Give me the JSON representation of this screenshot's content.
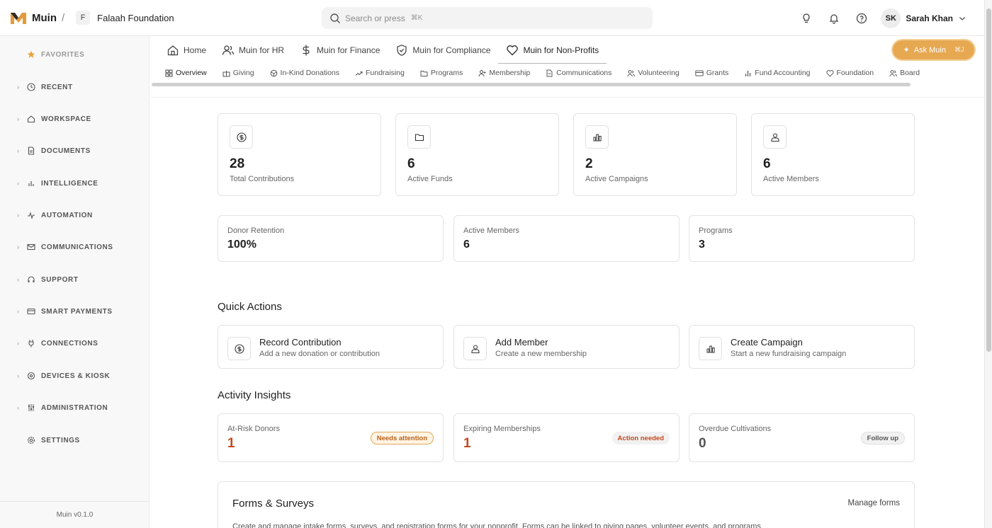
{
  "brand": {
    "name": "Muin",
    "accent": "#e7a852"
  },
  "org": {
    "initial": "F",
    "name": "Falaah Foundation"
  },
  "search": {
    "placeholder": "Search or press",
    "shortcut": "⌘K"
  },
  "user": {
    "initials": "SK",
    "name": "Sarah Khan"
  },
  "sidebar": {
    "items": [
      {
        "label": "FAVORITES",
        "icon": "star-icon"
      },
      {
        "label": "RECENT",
        "icon": "clock-icon"
      },
      {
        "label": "WORKSPACE",
        "icon": "home-icon"
      },
      {
        "label": "DOCUMENTS",
        "icon": "document-icon"
      },
      {
        "label": "INTELLIGENCE",
        "icon": "bar-chart-icon"
      },
      {
        "label": "AUTOMATION",
        "icon": "activity-icon"
      },
      {
        "label": "COMMUNICATIONS",
        "icon": "mail-icon"
      },
      {
        "label": "SUPPORT",
        "icon": "headset-icon"
      },
      {
        "label": "SMART PAYMENTS",
        "icon": "card-icon"
      },
      {
        "label": "CONNECTIONS",
        "icon": "plug-icon"
      },
      {
        "label": "DEVICES & KIOSK",
        "icon": "kiosk-icon"
      },
      {
        "label": "ADMINISTRATION",
        "icon": "sliders-icon"
      },
      {
        "label": "SETTINGS",
        "icon": "settings-icon"
      }
    ],
    "version": "Muin v0.1.0"
  },
  "main_tabs": [
    {
      "label": "Home",
      "icon": "home-icon"
    },
    {
      "label": "Muin for HR",
      "icon": "users-icon"
    },
    {
      "label": "Muin for Finance",
      "icon": "dollar-icon"
    },
    {
      "label": "Muin for Compliance",
      "icon": "shield-icon"
    },
    {
      "label": "Muin for Non-Profits",
      "icon": "heart-icon",
      "active": true
    }
  ],
  "ask_button": {
    "label": "Ask Muin",
    "shortcut": "⌘J"
  },
  "sub_tabs": [
    {
      "label": "Overview",
      "icon": "grid-icon",
      "active": true
    },
    {
      "label": "Giving",
      "icon": "gift-icon"
    },
    {
      "label": "In-Kind Donations",
      "icon": "package-icon"
    },
    {
      "label": "Fundraising",
      "icon": "trend-icon"
    },
    {
      "label": "Programs",
      "icon": "folder-icon"
    },
    {
      "label": "Membership",
      "icon": "user-plus-icon"
    },
    {
      "label": "Communications",
      "icon": "file-icon"
    },
    {
      "label": "Volunteering",
      "icon": "users-icon"
    },
    {
      "label": "Grants",
      "icon": "card-icon"
    },
    {
      "label": "Fund Accounting",
      "icon": "bar-chart-icon"
    },
    {
      "label": "Foundation",
      "icon": "heart-icon"
    },
    {
      "label": "Board",
      "icon": "users-icon"
    }
  ],
  "stats": [
    {
      "value": "28",
      "label": "Total Contributions",
      "icon": "dollar-circle-icon"
    },
    {
      "value": "6",
      "label": "Active Funds",
      "icon": "folder-icon"
    },
    {
      "value": "2",
      "label": "Active Campaigns",
      "icon": "bar-chart-icon"
    },
    {
      "value": "6",
      "label": "Active Members",
      "icon": "members-icon"
    }
  ],
  "metrics": [
    {
      "label": "Donor Retention",
      "value": "100%"
    },
    {
      "label": "Active Members",
      "value": "6"
    },
    {
      "label": "Programs",
      "value": "3"
    }
  ],
  "quick_actions": {
    "title": "Quick Actions",
    "items": [
      {
        "title": "Record Contribution",
        "desc": "Add a new donation or contribution",
        "icon": "dollar-circle-icon"
      },
      {
        "title": "Add Member",
        "desc": "Create a new membership",
        "icon": "members-icon"
      },
      {
        "title": "Create Campaign",
        "desc": "Start a new fundraising campaign",
        "icon": "bar-chart-icon"
      }
    ]
  },
  "insights": {
    "title": "Activity Insights",
    "items": [
      {
        "label": "At-Risk Donors",
        "value": "1",
        "badge": "Needs attention",
        "value_color": "#c24a1f"
      },
      {
        "label": "Expiring Memberships",
        "value": "1",
        "badge": "Action needed",
        "value_color": "#c24a1f"
      },
      {
        "label": "Overdue Cultivations",
        "value": "0",
        "badge": "Follow up",
        "value_color": "#555555"
      }
    ]
  },
  "forms": {
    "title": "Forms & Surveys",
    "link": "Manage forms",
    "desc": "Create and manage intake forms, surveys, and registration forms for your nonprofit. Forms can be linked to giving pages, volunteer events, and programs."
  }
}
